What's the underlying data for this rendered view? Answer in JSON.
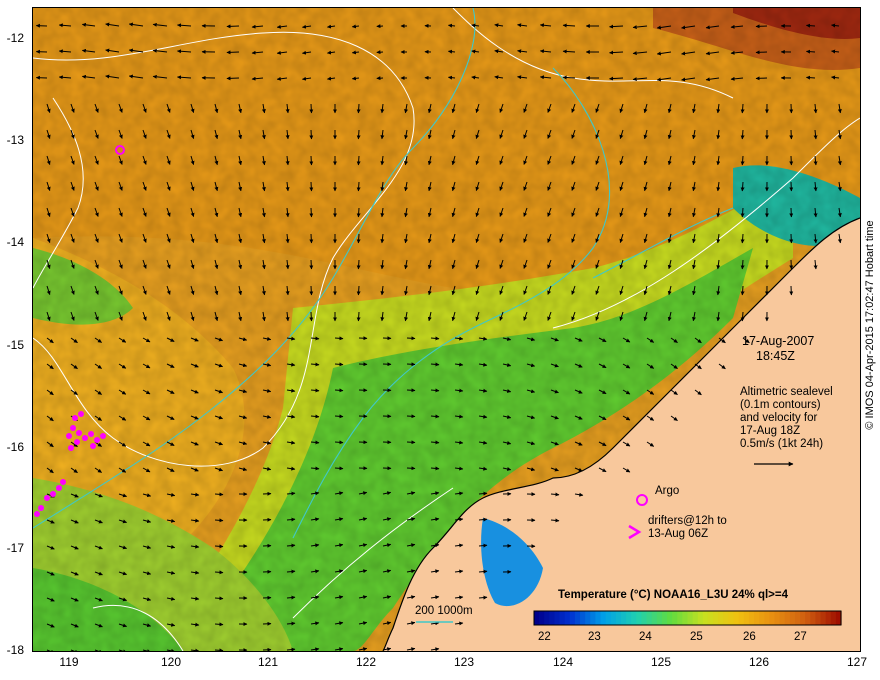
{
  "map": {
    "date": "17-Aug-2007",
    "time": "18:45Z",
    "lat_labels": [
      "-12",
      "-13",
      "-14",
      "-15",
      "-16",
      "-17",
      "-18"
    ],
    "lon_labels": [
      "119",
      "120",
      "121",
      "122",
      "123",
      "124",
      "125",
      "126",
      "127"
    ],
    "altimetry": {
      "line1": "Altimetric sealevel",
      "line2": "(0.1m contours)",
      "line3": "and velocity for",
      "line4": "17-Aug 18Z",
      "line5": "0.5m/s (1kt 24h)"
    },
    "argo_label": "Argo",
    "drifters_line1": "drifters@12h to",
    "drifters_line2": "13-Aug 06Z",
    "isobath_label": "200  1000m",
    "colorbar": {
      "title": "Temperature (°C) NOAA16_L3U 24% ql>=4",
      "ticks": [
        "22",
        "23",
        "24",
        "25",
        "26",
        "27"
      ],
      "colors": [
        "#00008b",
        "#0030d0",
        "#00a0e8",
        "#20d0b0",
        "#60dc40",
        "#c8e020",
        "#f0c010",
        "#e89010",
        "#d06010",
        "#a01000"
      ]
    },
    "credit": "© IMOS 04-Apr-2015 17:02:47 Hobart time",
    "colors": {
      "land": "#f8c89c",
      "warm": "#e8a020",
      "mid": "#c8dc20",
      "cool": "#30c840",
      "contour": "#ffffff",
      "isobath": "#40c8c8",
      "argo": "#ff00ff"
    }
  }
}
